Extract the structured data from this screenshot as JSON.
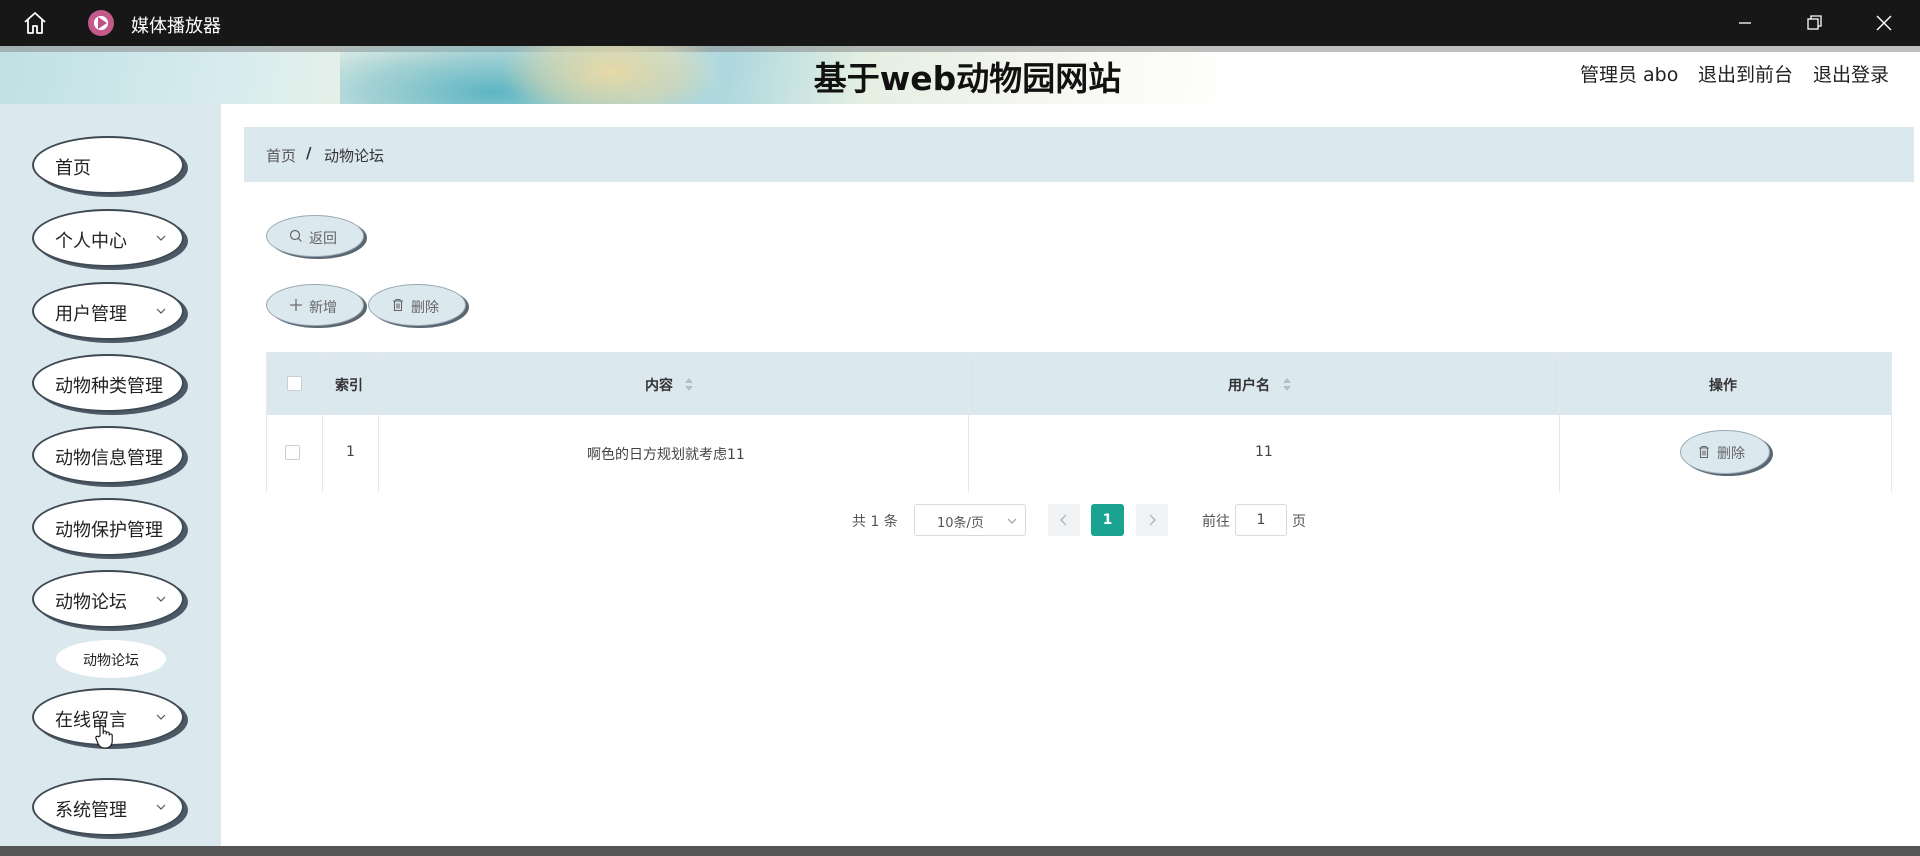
{
  "window": {
    "app_title": "媒体播放器"
  },
  "header": {
    "site_title": "基于web动物园网站",
    "admin_label": "管理员 abo",
    "exit_front_label": "退出到前台",
    "logout_label": "退出登录"
  },
  "sidebar": {
    "items": [
      {
        "label": "首页",
        "expandable": false
      },
      {
        "label": "个人中心",
        "expandable": true
      },
      {
        "label": "用户管理",
        "expandable": true
      },
      {
        "label": "动物种类管理",
        "expandable": false
      },
      {
        "label": "动物信息管理",
        "expandable": false
      },
      {
        "label": "动物保护管理",
        "expandable": false
      },
      {
        "label": "动物论坛",
        "expandable": true
      },
      {
        "label": "在线留言",
        "expandable": true
      },
      {
        "label": "系统管理",
        "expandable": true
      }
    ],
    "sub_item": "动物论坛"
  },
  "breadcrumb": {
    "home": "首页",
    "separator": "/",
    "current": "动物论坛"
  },
  "toolbar": {
    "back_label": "返回",
    "add_label": "新增",
    "delete_label": "删除"
  },
  "table": {
    "columns": [
      "索引",
      "内容",
      "用户名",
      "操作"
    ],
    "rows": [
      {
        "index": "1",
        "content": "啊色的日方规划就考虑11",
        "username": "11",
        "action": "删除"
      }
    ]
  },
  "pagination": {
    "total": "共 1 条",
    "page_size": "10条/页",
    "current_page": "1",
    "goto_label": "前往",
    "goto_value": "1",
    "page_label": "页"
  },
  "colors": {
    "accent": "#1aa390",
    "panel": "#dbe8ee",
    "titlebar": "#171717"
  }
}
